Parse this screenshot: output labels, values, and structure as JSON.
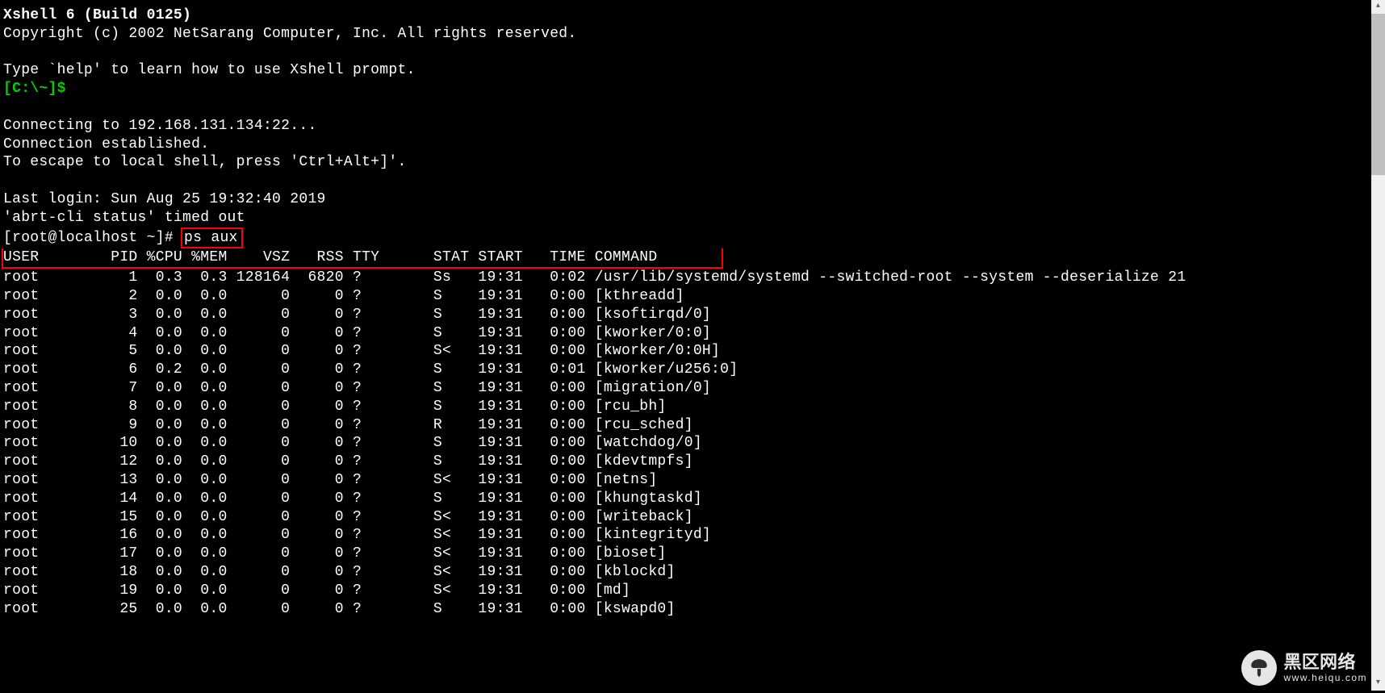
{
  "header": {
    "title": "Xshell 6 (Build 0125)",
    "copyright": "Copyright (c) 2002 NetSarang Computer, Inc. All rights reserved.",
    "help": "Type `help' to learn how to use Xshell prompt.",
    "local_prompt": "[C:\\~]$"
  },
  "conn": {
    "connecting": "Connecting to 192.168.131.134:22...",
    "established": "Connection established.",
    "escape": "To escape to local shell, press 'Ctrl+Alt+]'."
  },
  "session": {
    "last_login": "Last login: Sun Aug 25 19:32:40 2019",
    "abrt": "'abrt-cli status' timed out",
    "prompt": "[root@localhost ~]# ",
    "command": "ps aux"
  },
  "ps": {
    "header": "USER        PID %CPU %MEM    VSZ   RSS TTY      STAT START   TIME COMMAND",
    "header_padding": "       ",
    "rows": [
      {
        "user": "root",
        "pid": "1",
        "cpu": "0.3",
        "mem": "0.3",
        "vsz": "128164",
        "rss": "6820",
        "tty": "?",
        "stat": "Ss",
        "start": "19:31",
        "time": "0:02",
        "command": "/usr/lib/systemd/systemd --switched-root --system --deserialize 21"
      },
      {
        "user": "root",
        "pid": "2",
        "cpu": "0.0",
        "mem": "0.0",
        "vsz": "0",
        "rss": "0",
        "tty": "?",
        "stat": "S",
        "start": "19:31",
        "time": "0:00",
        "command": "[kthreadd]"
      },
      {
        "user": "root",
        "pid": "3",
        "cpu": "0.0",
        "mem": "0.0",
        "vsz": "0",
        "rss": "0",
        "tty": "?",
        "stat": "S",
        "start": "19:31",
        "time": "0:00",
        "command": "[ksoftirqd/0]"
      },
      {
        "user": "root",
        "pid": "4",
        "cpu": "0.0",
        "mem": "0.0",
        "vsz": "0",
        "rss": "0",
        "tty": "?",
        "stat": "S",
        "start": "19:31",
        "time": "0:00",
        "command": "[kworker/0:0]"
      },
      {
        "user": "root",
        "pid": "5",
        "cpu": "0.0",
        "mem": "0.0",
        "vsz": "0",
        "rss": "0",
        "tty": "?",
        "stat": "S<",
        "start": "19:31",
        "time": "0:00",
        "command": "[kworker/0:0H]"
      },
      {
        "user": "root",
        "pid": "6",
        "cpu": "0.2",
        "mem": "0.0",
        "vsz": "0",
        "rss": "0",
        "tty": "?",
        "stat": "S",
        "start": "19:31",
        "time": "0:01",
        "command": "[kworker/u256:0]"
      },
      {
        "user": "root",
        "pid": "7",
        "cpu": "0.0",
        "mem": "0.0",
        "vsz": "0",
        "rss": "0",
        "tty": "?",
        "stat": "S",
        "start": "19:31",
        "time": "0:00",
        "command": "[migration/0]"
      },
      {
        "user": "root",
        "pid": "8",
        "cpu": "0.0",
        "mem": "0.0",
        "vsz": "0",
        "rss": "0",
        "tty": "?",
        "stat": "S",
        "start": "19:31",
        "time": "0:00",
        "command": "[rcu_bh]"
      },
      {
        "user": "root",
        "pid": "9",
        "cpu": "0.0",
        "mem": "0.0",
        "vsz": "0",
        "rss": "0",
        "tty": "?",
        "stat": "R",
        "start": "19:31",
        "time": "0:00",
        "command": "[rcu_sched]"
      },
      {
        "user": "root",
        "pid": "10",
        "cpu": "0.0",
        "mem": "0.0",
        "vsz": "0",
        "rss": "0",
        "tty": "?",
        "stat": "S",
        "start": "19:31",
        "time": "0:00",
        "command": "[watchdog/0]"
      },
      {
        "user": "root",
        "pid": "12",
        "cpu": "0.0",
        "mem": "0.0",
        "vsz": "0",
        "rss": "0",
        "tty": "?",
        "stat": "S",
        "start": "19:31",
        "time": "0:00",
        "command": "[kdevtmpfs]"
      },
      {
        "user": "root",
        "pid": "13",
        "cpu": "0.0",
        "mem": "0.0",
        "vsz": "0",
        "rss": "0",
        "tty": "?",
        "stat": "S<",
        "start": "19:31",
        "time": "0:00",
        "command": "[netns]"
      },
      {
        "user": "root",
        "pid": "14",
        "cpu": "0.0",
        "mem": "0.0",
        "vsz": "0",
        "rss": "0",
        "tty": "?",
        "stat": "S",
        "start": "19:31",
        "time": "0:00",
        "command": "[khungtaskd]"
      },
      {
        "user": "root",
        "pid": "15",
        "cpu": "0.0",
        "mem": "0.0",
        "vsz": "0",
        "rss": "0",
        "tty": "?",
        "stat": "S<",
        "start": "19:31",
        "time": "0:00",
        "command": "[writeback]"
      },
      {
        "user": "root",
        "pid": "16",
        "cpu": "0.0",
        "mem": "0.0",
        "vsz": "0",
        "rss": "0",
        "tty": "?",
        "stat": "S<",
        "start": "19:31",
        "time": "0:00",
        "command": "[kintegrityd]"
      },
      {
        "user": "root",
        "pid": "17",
        "cpu": "0.0",
        "mem": "0.0",
        "vsz": "0",
        "rss": "0",
        "tty": "?",
        "stat": "S<",
        "start": "19:31",
        "time": "0:00",
        "command": "[bioset]"
      },
      {
        "user": "root",
        "pid": "18",
        "cpu": "0.0",
        "mem": "0.0",
        "vsz": "0",
        "rss": "0",
        "tty": "?",
        "stat": "S<",
        "start": "19:31",
        "time": "0:00",
        "command": "[kblockd]"
      },
      {
        "user": "root",
        "pid": "19",
        "cpu": "0.0",
        "mem": "0.0",
        "vsz": "0",
        "rss": "0",
        "tty": "?",
        "stat": "S<",
        "start": "19:31",
        "time": "0:00",
        "command": "[md]"
      },
      {
        "user": "root",
        "pid": "25",
        "cpu": "0.0",
        "mem": "0.0",
        "vsz": "0",
        "rss": "0",
        "tty": "?",
        "stat": "S",
        "start": "19:31",
        "time": "0:00",
        "command": "[kswapd0]"
      }
    ]
  },
  "watermark": {
    "title": "黑区网络",
    "url": "www.heiqu.com"
  }
}
